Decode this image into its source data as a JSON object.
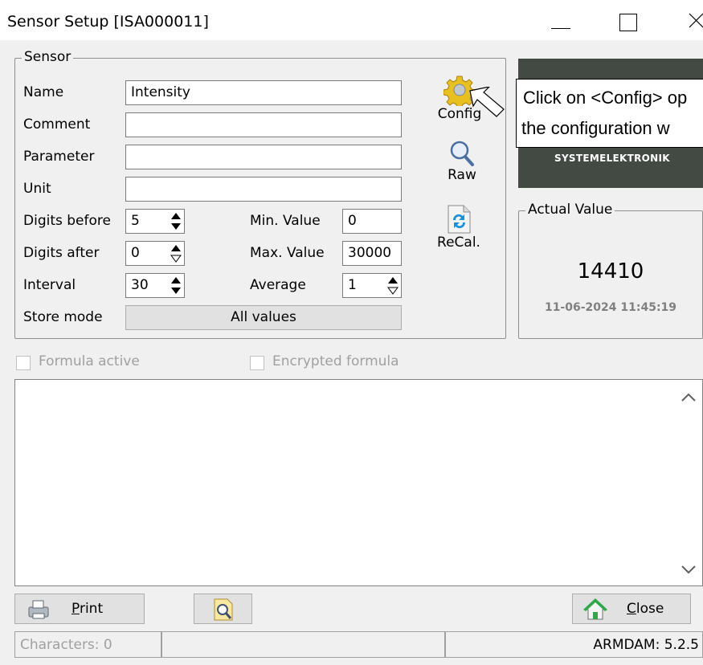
{
  "window": {
    "title": "Sensor Setup [ISA000011]"
  },
  "sensor": {
    "group_label": "Sensor",
    "name_label": "Name",
    "name_value": "Intensity",
    "comment_label": "Comment",
    "comment_value": "",
    "parameter_label": "Parameter",
    "parameter_value": "",
    "unit_label": "Unit",
    "unit_value": "",
    "digits_before_label": "Digits before",
    "digits_before_value": "5",
    "digits_after_label": "Digits after",
    "digits_after_value": "0",
    "interval_label": "Interval",
    "interval_value": "30",
    "min_value_label": "Min. Value",
    "min_value_value": "0",
    "max_value_label": "Max. Value",
    "max_value_value": "30000",
    "average_label": "Average",
    "average_value": "1",
    "store_mode_label": "Store mode",
    "store_mode_value": "All values"
  },
  "tools": {
    "config_label": "Config",
    "raw_label": "Raw",
    "recal_label": "ReCal."
  },
  "logo": {
    "brand_text": "SYSTEMELEKTRONIK"
  },
  "tooltip": {
    "line1": "Click on <Config> op",
    "line2": "the configuration w"
  },
  "actual": {
    "group_label": "Actual Value",
    "value": "14410",
    "timestamp": "11-06-2024 11:45:19"
  },
  "formula": {
    "active_label": "Formula active",
    "encrypted_label": "Encrypted formula",
    "text": ""
  },
  "buttons": {
    "print_prefix": "",
    "print_underlined": "P",
    "print_rest": "rint",
    "close_underlined": "C",
    "close_rest": "lose"
  },
  "status": {
    "characters": "Characters: 0",
    "middle": "",
    "version": "ARMDAM: 5.2.5"
  },
  "colors": {
    "logo_bg": "#434a43",
    "config_icon": "#e8c020",
    "recal_icon": "#1e90d8",
    "disabled_text": "#a0a0a0"
  }
}
